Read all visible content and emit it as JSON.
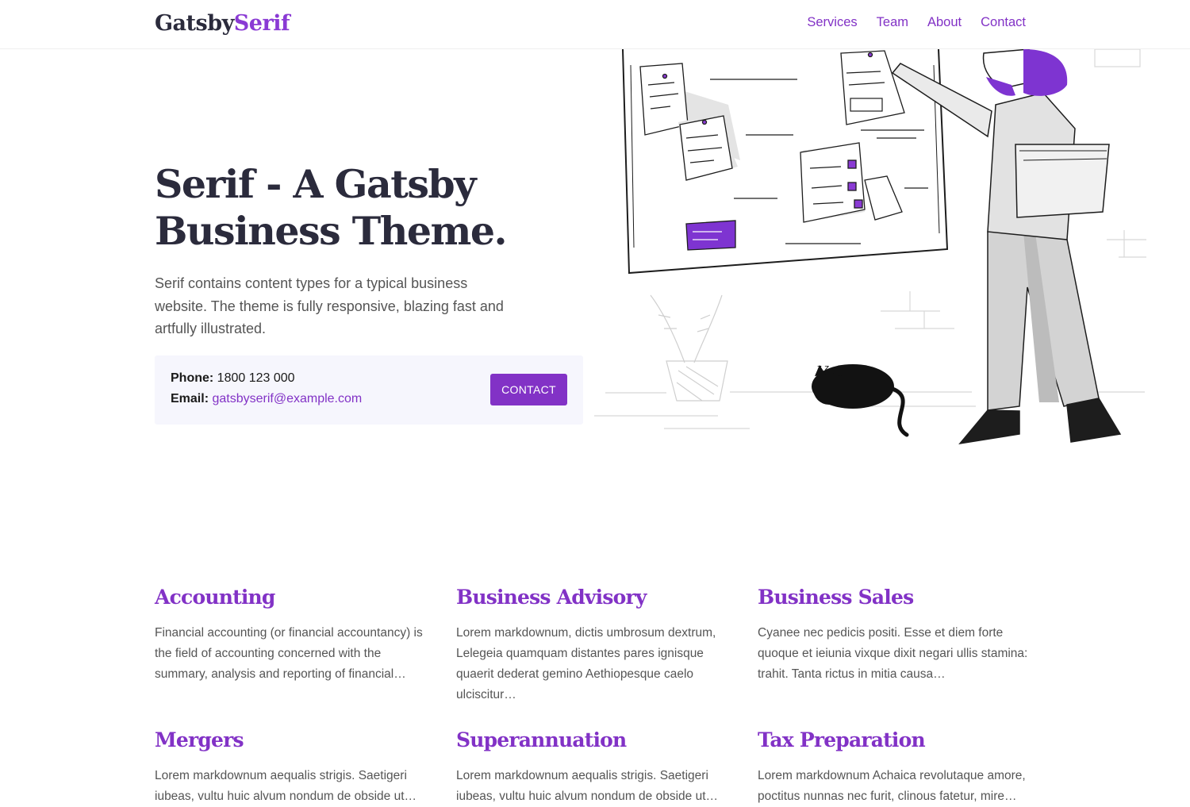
{
  "header": {
    "logo_part1": "Gatsby",
    "logo_part2": "Serif",
    "nav": [
      "Services",
      "Team",
      "About",
      "Contact"
    ]
  },
  "hero": {
    "title_line1": "Serif - A Gatsby",
    "title_line2": "Business Theme.",
    "description": "Serif contains content types for a typical business website. The theme is fully responsive, blazing fast and artfully illustrated."
  },
  "call": {
    "phone_label": "Phone:",
    "phone": "1800 123 000",
    "email_label": "Email:",
    "email": "gatsbyserif@example.com",
    "button": "CONTACT"
  },
  "services": [
    {
      "title": "Accounting",
      "text": "Financial accounting (or financial accountancy) is the field of accounting concerned with the summary, analysis and reporting of financial…"
    },
    {
      "title": "Business Advisory",
      "text": "Lorem markdownum, dictis umbrosum dextrum, Lelegeia quamquam distantes pares ignisque quaerit dederat gemino Aethiopesque caelo ulciscitur…"
    },
    {
      "title": "Business Sales",
      "text": "Cyanee nec pedicis positi. Esse et diem forte quoque et ieiunia vixque dixit negari ullis stamina: trahit. Tanta rictus in mitia causa…"
    },
    {
      "title": "Mergers",
      "text": "Lorem markdownum aequalis strigis. Saetigeri iubeas, vultu huic alvum nondum de obside ut…"
    },
    {
      "title": "Superannuation",
      "text": "Lorem markdownum aequalis strigis. Saetigeri iubeas, vultu huic alvum nondum de obside ut…"
    },
    {
      "title": "Tax Preparation",
      "text": "Lorem markdownum Achaica revolutaque amore, poctitus nunnas nec furit, clinous fatetur, mire…"
    }
  ],
  "colors": {
    "accent": "#8232c6",
    "heading": "#2b2b3c",
    "call_bg": "#f6f6fd"
  }
}
